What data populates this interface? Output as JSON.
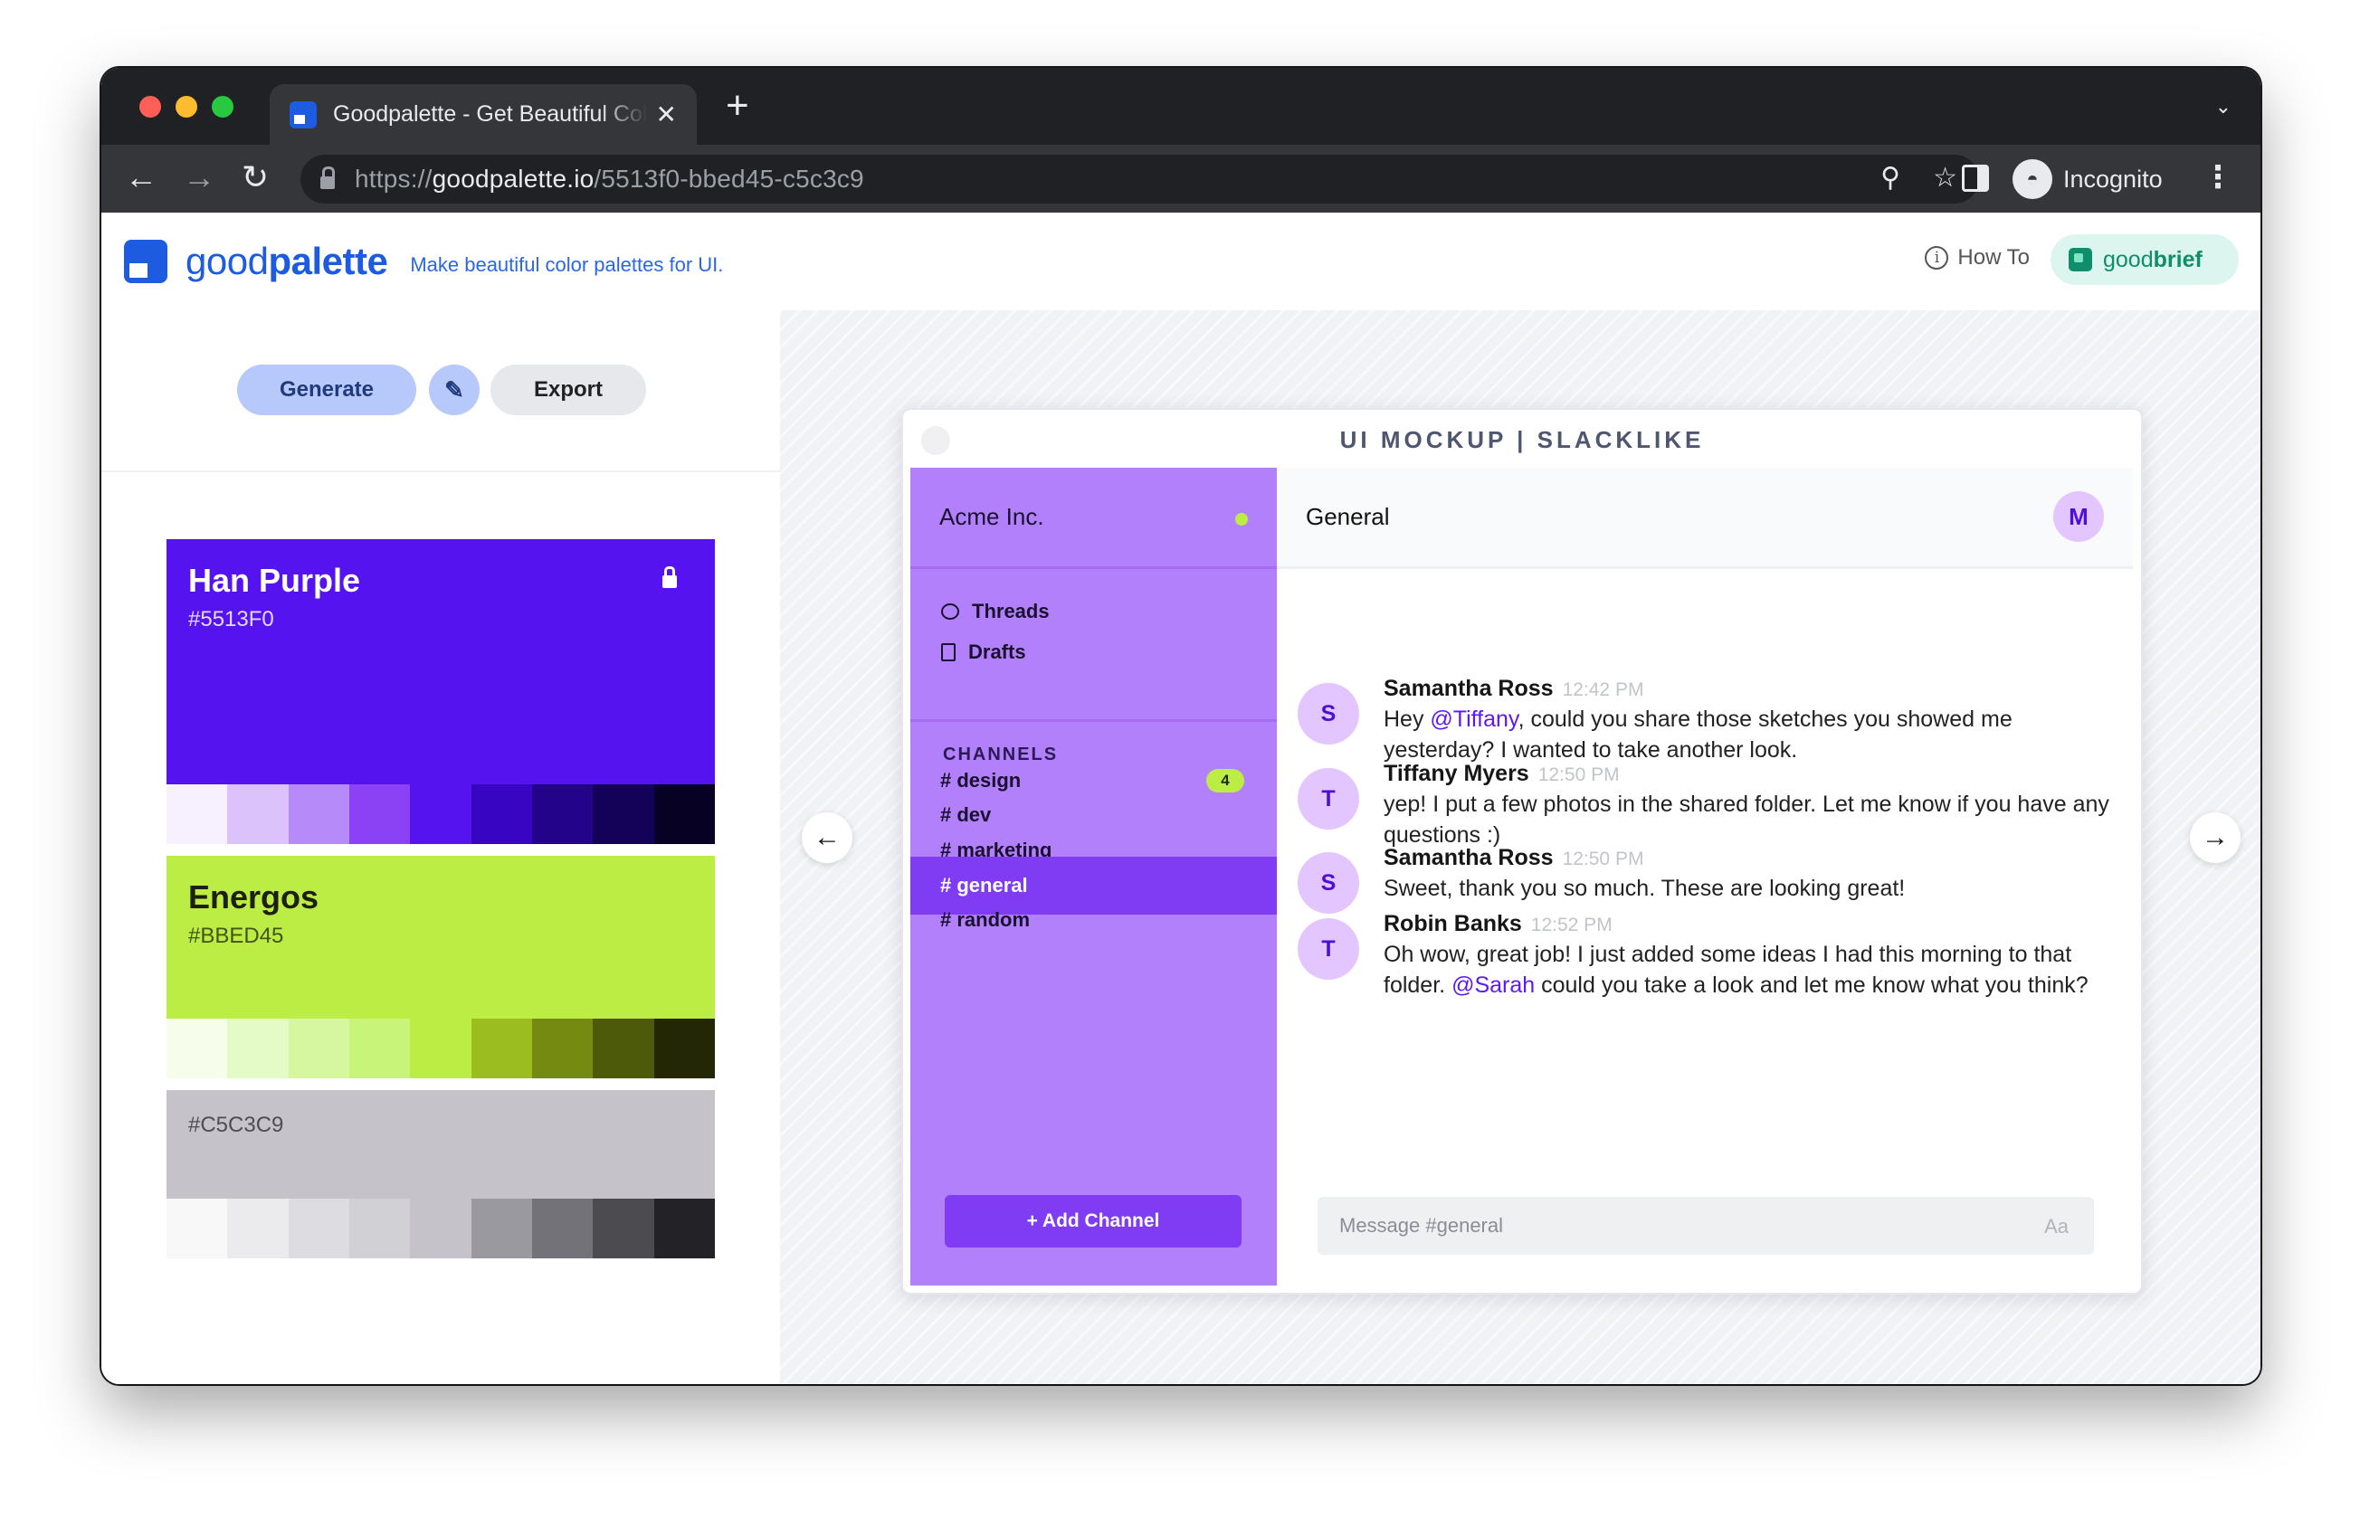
{
  "browser": {
    "tab_title": "Goodpalette - Get Beautiful Color Palettes",
    "url_scheme": "https://",
    "url_domain": "goodpalette.io",
    "url_path": "/5513f0-bbed45-c5c3c9",
    "incognito_label": "Incognito"
  },
  "header": {
    "logo_light": "good",
    "logo_bold": "palette",
    "tagline": "Make beautiful color palettes for UI.",
    "how_to": "How To",
    "goodbrief_light": "good",
    "goodbrief_bold": "brief"
  },
  "actions": {
    "generate": "Generate",
    "picker_icon": "eyedropper-icon",
    "export": "Export"
  },
  "palette": [
    {
      "name": "Han Purple",
      "hex": "#5513F0",
      "locked": true,
      "shades": [
        "#f7f0ff",
        "#dcc2fb",
        "#b78af9",
        "#8b42f4",
        "#5513f0",
        "#3806c2",
        "#22038a",
        "#130257",
        "#070224"
      ]
    },
    {
      "name": "Energos",
      "hex": "#BBED45",
      "locked": false,
      "shades": [
        "#f6fdea",
        "#e5fbc7",
        "#d6f79f",
        "#c8f47a",
        "#bbed45",
        "#9bbd20",
        "#748a10",
        "#4d5a0a",
        "#242705"
      ]
    },
    {
      "name": "",
      "hex": "#C5C3C9",
      "locked": false,
      "shades": [
        "#f8f8f9",
        "#ebeaed",
        "#dddce0",
        "#d1d0d4",
        "#c5c3c9",
        "#9a99a0",
        "#737279",
        "#4c4b50",
        "#232226"
      ]
    }
  ],
  "mockup": {
    "title": "UI MOCKUP | SLACKLIKE",
    "team": "Acme Inc.",
    "threads": "Threads",
    "drafts": "Drafts",
    "channels_heading": "CHANNELS",
    "channels": [
      {
        "label": "# design",
        "badge": "4"
      },
      {
        "label": "# dev",
        "badge": ""
      },
      {
        "label": "# marketing",
        "badge": ""
      },
      {
        "label": "# general",
        "badge": ""
      },
      {
        "label": "# random",
        "badge": ""
      }
    ],
    "active_channel": "# general",
    "add_channel": "+ Add Channel",
    "channel_title": "General",
    "me_initial": "M",
    "messages": [
      {
        "initial": "S",
        "name": "Samantha Ross",
        "time": "12:42 PM",
        "pre": "Hey ",
        "mention": "@Tiffany",
        "post": ", could you share those sketches you showed me yesterday? I wanted to take another look."
      },
      {
        "initial": "T",
        "name": "Tiffany Myers",
        "time": "12:50 PM",
        "pre": "yep! I put a few photos in the shared folder. Let me know if you have any questions :)",
        "mention": "",
        "post": ""
      },
      {
        "initial": "S",
        "name": "Samantha Ross",
        "time": "12:50 PM",
        "pre": "Sweet, thank you so much. These are looking great!",
        "mention": "",
        "post": ""
      },
      {
        "initial": "T",
        "name": "Robin Banks",
        "time": "12:52 PM",
        "pre": "Oh wow, great job! I just added some ideas I had this morning to that folder. ",
        "mention": "@Sarah",
        "post": " could you take a look and let me know what you think?"
      }
    ],
    "compose_placeholder": "Message #general",
    "compose_format": "Aa"
  }
}
